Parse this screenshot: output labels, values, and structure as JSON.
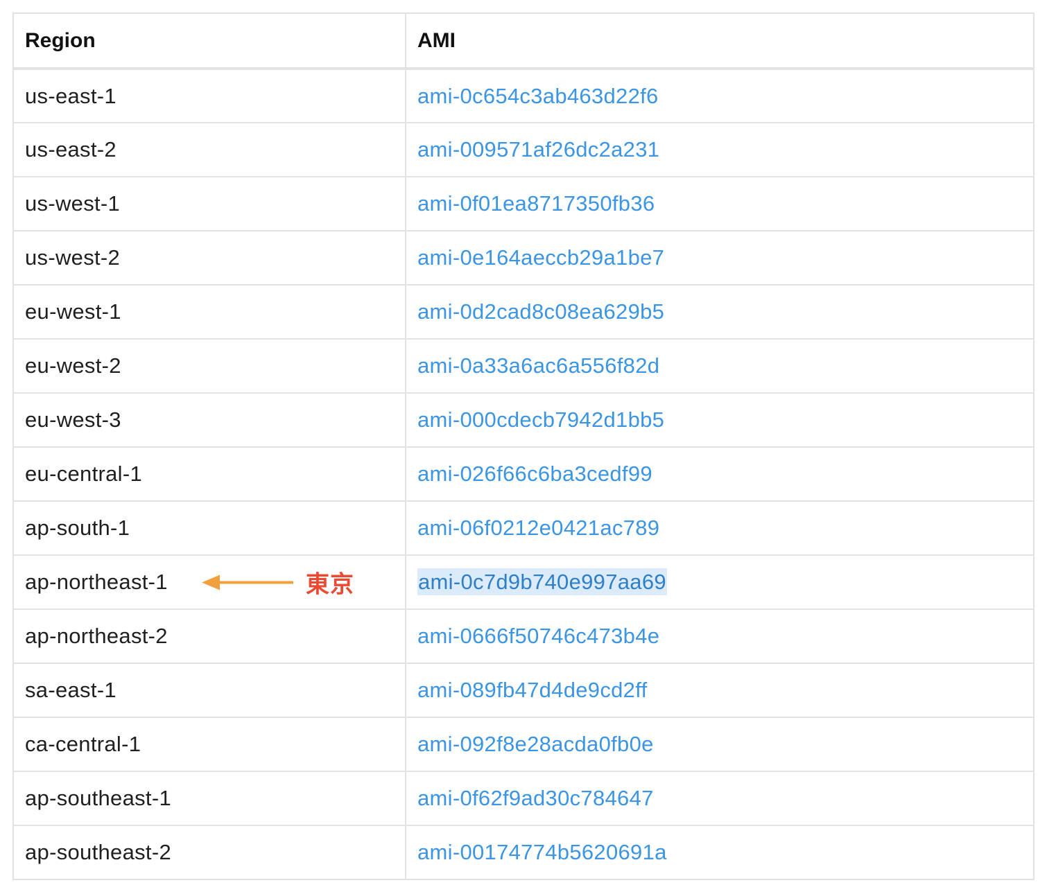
{
  "table": {
    "headers": {
      "region": "Region",
      "ami": "AMI"
    },
    "rows": [
      {
        "region": "us-east-1",
        "ami": "ami-0c654c3ab463d22f6"
      },
      {
        "region": "us-east-2",
        "ami": "ami-009571af26dc2a231"
      },
      {
        "region": "us-west-1",
        "ami": "ami-0f01ea8717350fb36"
      },
      {
        "region": "us-west-2",
        "ami": "ami-0e164aeccb29a1be7"
      },
      {
        "region": "eu-west-1",
        "ami": "ami-0d2cad8c08ea629b5"
      },
      {
        "region": "eu-west-2",
        "ami": "ami-0a33a6ac6a556f82d"
      },
      {
        "region": "eu-west-3",
        "ami": "ami-000cdecb7942d1bb5"
      },
      {
        "region": "eu-central-1",
        "ami": "ami-026f66c6ba3cedf99"
      },
      {
        "region": "ap-south-1",
        "ami": "ami-06f0212e0421ac789"
      },
      {
        "region": "ap-northeast-1",
        "ami": "ami-0c7d9b740e997aa69",
        "annotation": "東京",
        "selected": true
      },
      {
        "region": "ap-northeast-2",
        "ami": "ami-0666f50746c473b4e"
      },
      {
        "region": "sa-east-1",
        "ami": "ami-089fb47d4de9cd2ff"
      },
      {
        "region": "ca-central-1",
        "ami": "ami-092f8e28acda0fb0e"
      },
      {
        "region": "ap-southeast-1",
        "ami": "ami-0f62f9ad30c784647"
      },
      {
        "region": "ap-southeast-2",
        "ami": "ami-00174774b5620691a"
      }
    ]
  },
  "colors": {
    "link": "#3b95e3",
    "selection_bg": "#dcebf9",
    "annotation_text": "#e94a32",
    "annotation_arrow": "#f0a03c",
    "border": "#e2e2e2"
  },
  "icons": {
    "annotation_arrow": "arrow-left-icon"
  }
}
